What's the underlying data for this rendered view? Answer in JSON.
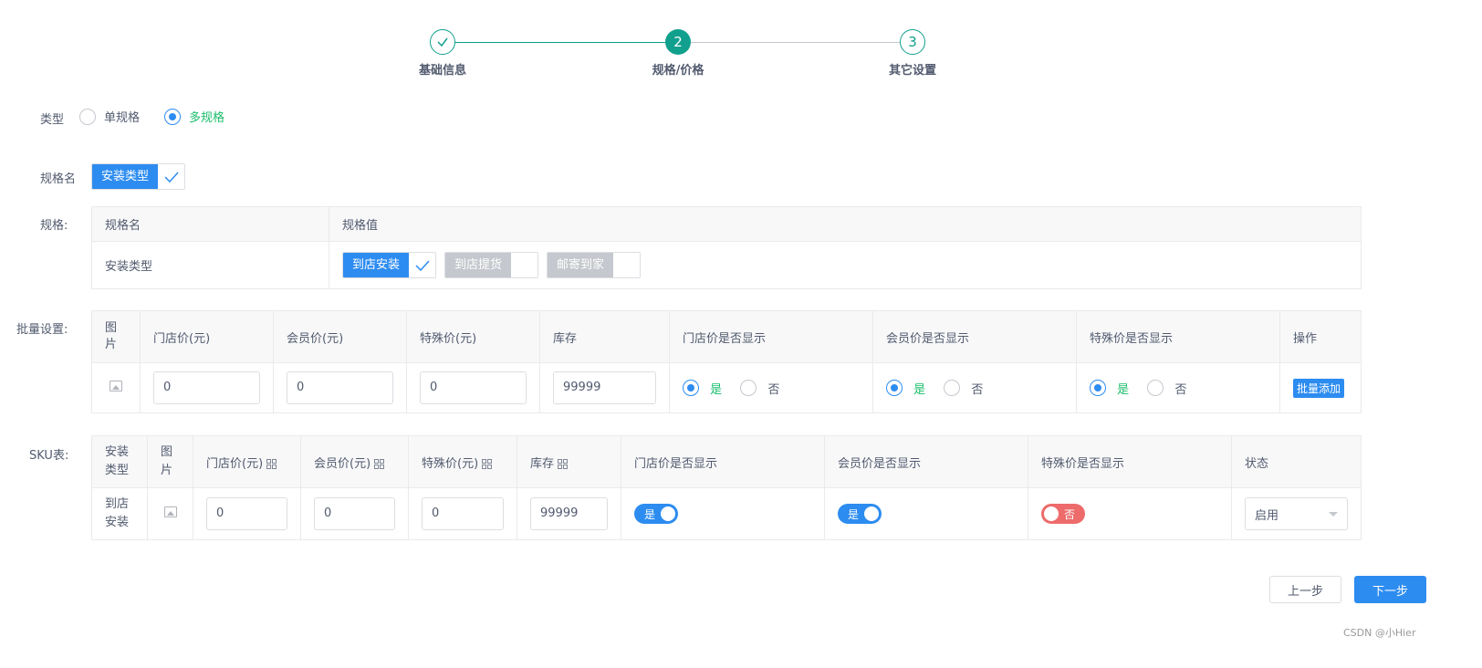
{
  "steps": [
    {
      "title": "基础信息",
      "status": "done",
      "index": "1"
    },
    {
      "title": "规格/价格",
      "status": "current",
      "index": "2"
    },
    {
      "title": "其它设置",
      "status": "wait",
      "index": "3"
    }
  ],
  "type": {
    "label": "类型",
    "options": [
      "单规格",
      "多规格"
    ],
    "selected": "多规格"
  },
  "spec_name": {
    "label": "规格名",
    "tag": "安装类型"
  },
  "spec": {
    "label": "规格:",
    "headers": [
      "规格名",
      "规格值"
    ],
    "row_name": "安装类型",
    "values": [
      {
        "label": "到店安装",
        "checked": true
      },
      {
        "label": "到店提货",
        "checked": false
      },
      {
        "label": "邮寄到家",
        "checked": false
      }
    ]
  },
  "batch": {
    "label": "批量设置:",
    "headers": [
      "图片",
      "门店价(元)",
      "会员价(元)",
      "特殊价(元)",
      "库存",
      "门店价是否显示",
      "会员价是否显示",
      "特殊价是否显示",
      "操作"
    ],
    "store_price": "0",
    "member_price": "0",
    "special_price": "0",
    "stock": "99999",
    "yes": "是",
    "no": "否",
    "action": "批量添加"
  },
  "sku": {
    "label": "SKU表:",
    "headers": [
      "安装类型",
      "图片",
      "门店价(元)",
      "会员价(元)",
      "特殊价(元)",
      "库存",
      "门店价是否显示",
      "会员价是否显示",
      "特殊价是否显示",
      "状态"
    ],
    "row": {
      "type": "到店安装",
      "store_price": "0",
      "member_price": "0",
      "special_price": "0",
      "stock": "99999",
      "store_show": "是",
      "member_show": "是",
      "special_show": "否",
      "status": "启用"
    }
  },
  "buttons": {
    "prev": "上一步",
    "next": "下一步"
  },
  "watermark": "CSDN @小Hier",
  "colors": {
    "primary": "#2d8cf0",
    "step": "#19be6b",
    "step_teal": "#11a08e",
    "switch_off": "#ed6b6b",
    "checked_text": "#19be6b",
    "tag_disabled": "#c5c8ce"
  }
}
